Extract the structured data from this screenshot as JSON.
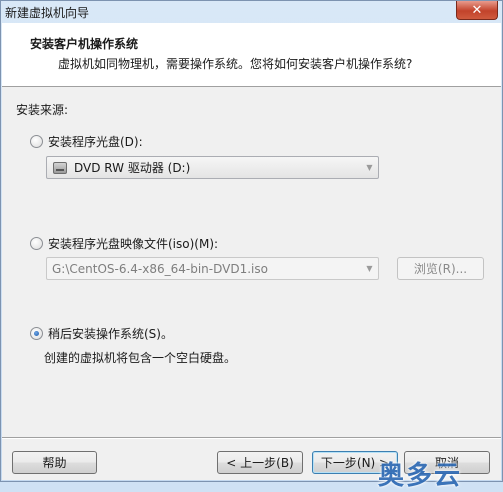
{
  "window": {
    "title": "新建虚拟机向导",
    "close_glyph": "✕"
  },
  "header": {
    "title": "安装客户机操作系统",
    "subtitle": "虚拟机如同物理机，需要操作系统。您将如何安装客户机操作系统?"
  },
  "install_source": {
    "label": "安装来源:",
    "options": [
      {
        "label": "安装程序光盘(D):",
        "selected": false,
        "select_value": "DVD RW 驱动器 (D:)",
        "select_icon": "dvd-drive-icon"
      },
      {
        "label": "安装程序光盘映像文件(iso)(M):",
        "selected": false,
        "select_value": "G:\\CentOS-6.4-x86_64-bin-DVD1.iso",
        "browse_label": "浏览(R)..."
      },
      {
        "label": "稍后安装操作系统(S)。",
        "selected": true,
        "description": "创建的虚拟机将包含一个空白硬盘。"
      }
    ]
  },
  "footer": {
    "help": "帮助",
    "back": "< 上一步(B)",
    "next": "下一步(N) >",
    "cancel": "取消"
  },
  "watermark": "奥多云",
  "colors": {
    "radio_selected": "#1a58a8",
    "watermark": "#2f6bb5"
  }
}
